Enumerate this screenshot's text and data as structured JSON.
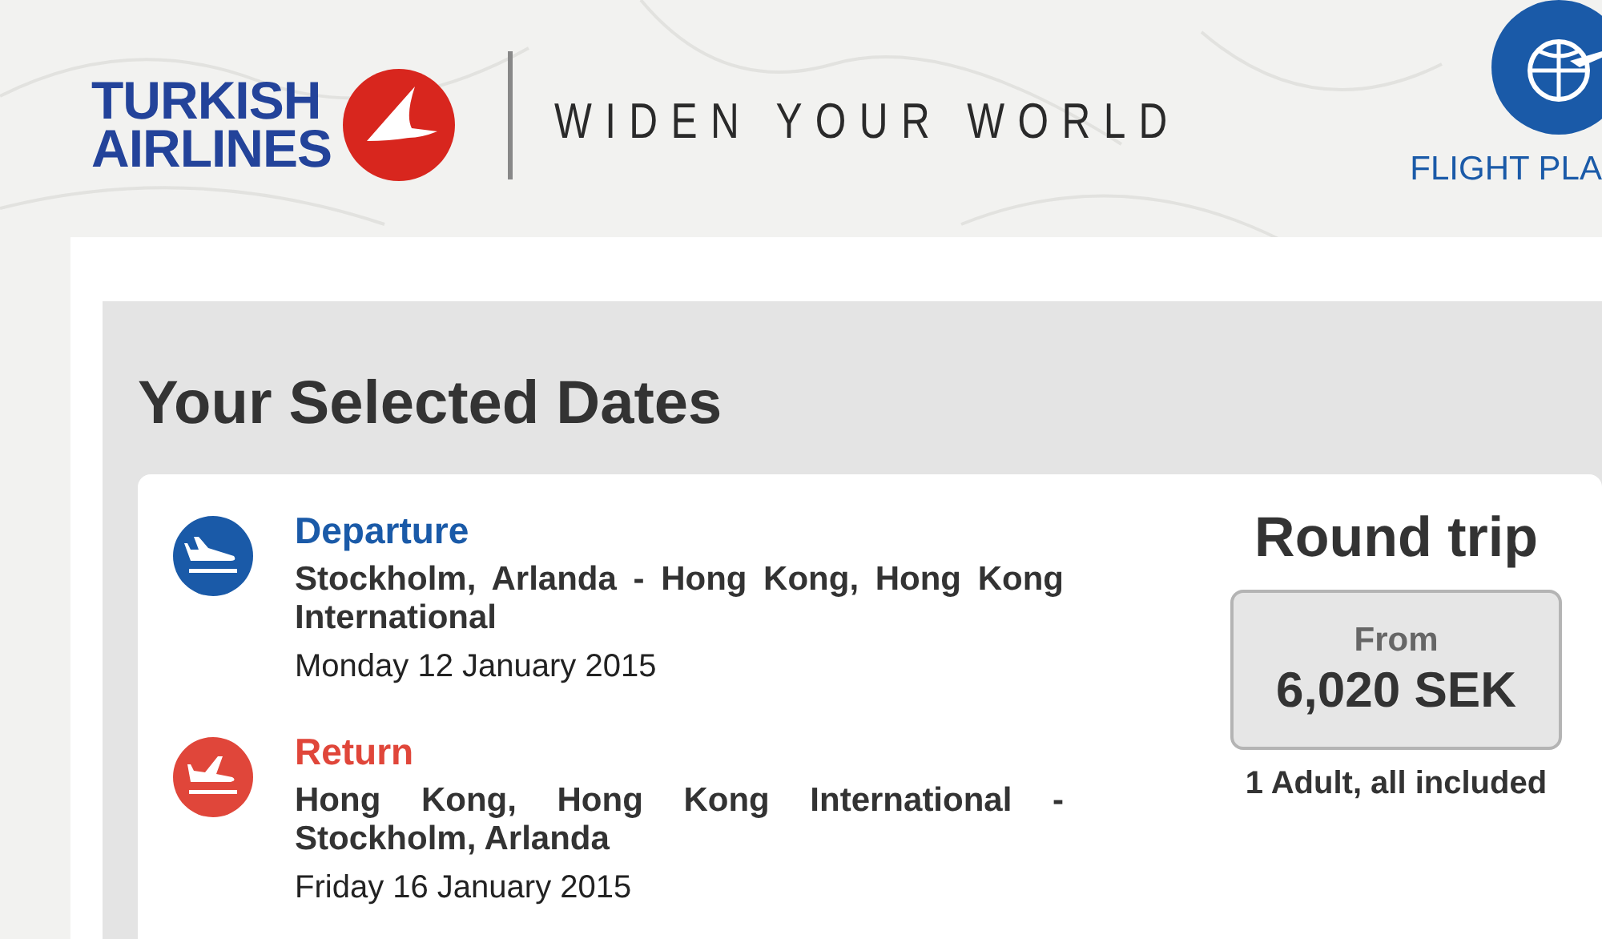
{
  "header": {
    "logo_text": [
      "TURKISH",
      "AIRLINES"
    ],
    "tagline": "WIDEN YOUR WORLD",
    "nav_item": "FLIGHT PLA"
  },
  "title": "Your Selected Dates",
  "legs": [
    {
      "kind": "departure",
      "label": "Departure",
      "color": "#1a5aa8",
      "route": "Stockholm, Arlanda - Hong Kong, Hong Kong International",
      "date": "Monday 12 January 2015"
    },
    {
      "kind": "return",
      "label": "Return",
      "color": "#e0463a",
      "route": "Hong Kong, Hong Kong International - Stockholm, Arlanda",
      "date": "Friday 16 January 2015"
    }
  ],
  "fare": {
    "trip_type": "Round trip",
    "from_label": "From",
    "price": "6,020 SEK",
    "note": "1 Adult, all included"
  }
}
